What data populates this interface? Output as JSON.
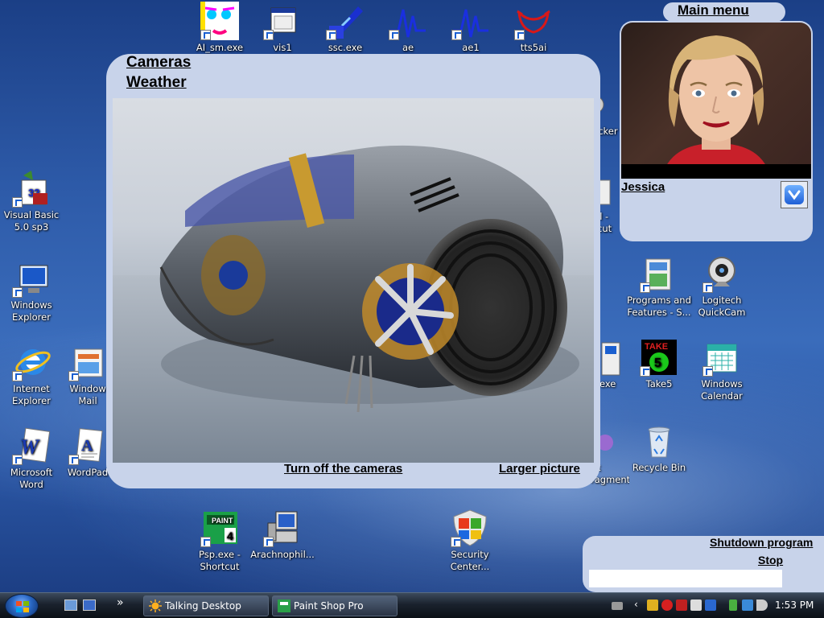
{
  "desktop_icons": [
    {
      "label": "AI_sm.exe",
      "icon": "ai-face-icon"
    },
    {
      "label": "vis1",
      "icon": "vis-app-icon"
    },
    {
      "label": "ssc.exe",
      "icon": "ssc-app-icon"
    },
    {
      "label": "ae",
      "icon": "waveform-icon"
    },
    {
      "label": "ae1",
      "icon": "waveform-icon"
    },
    {
      "label": "tts5ai",
      "icon": "tts-mouth-icon"
    },
    {
      "label": "Visual Basic\n5.0 sp3",
      "icon": "visual-basic-icon"
    },
    {
      "label": "Windows\nExplorer",
      "icon": "windows-explorer-icon"
    },
    {
      "label": "Internet\nExplorer",
      "icon": "internet-explorer-icon"
    },
    {
      "label": "Window\nMail",
      "icon": "windows-mail-icon"
    },
    {
      "label": "Microsoft\nWord",
      "icon": "word-icon"
    },
    {
      "label": "WordPad",
      "icon": "wordpad-icon"
    },
    {
      "label": "Psp.exe -\nShortcut",
      "icon": "paint-shop-pro-icon"
    },
    {
      "label": "Arachnophil...",
      "icon": "computer-icon"
    },
    {
      "label": "Security\nCenter...",
      "icon": "security-shield-icon"
    },
    {
      "label": "Programs and\nFeatures - S...",
      "icon": "programs-features-icon"
    },
    {
      "label": "Logitech\nQuickCam",
      "icon": "webcam-icon"
    },
    {
      "label": "Take5",
      "icon": "take5-icon"
    },
    {
      "label": "Windows\nCalendar",
      "icon": "calendar-icon"
    },
    {
      "label": "Recycle Bin",
      "icon": "recycle-bin-icon"
    },
    {
      "label": "icker",
      "icon": "partial-icon"
    },
    {
      "label": "il -\ncut",
      "icon": "partial-icon"
    },
    {
      "label": "p.exe",
      "icon": "partial-icon"
    },
    {
      "label": "sk\nragmenter",
      "icon": "partial-icon"
    }
  ],
  "camera_panel": {
    "cameras_link": "Cameras",
    "weather_link": "Weather",
    "turn_off_link": "Turn off the cameras",
    "larger_picture_link": "Larger picture"
  },
  "avatar_panel": {
    "main_menu_link": "Main menu",
    "character_name": "Jessica"
  },
  "shutdown_panel": {
    "shutdown_link": "Shutdown program",
    "stop_link": "Stop",
    "input_value": ""
  },
  "taskbar": {
    "buttons": [
      {
        "label": "Talking Desktop",
        "icon": "sun-icon"
      },
      {
        "label": "Paint Shop Pro",
        "icon": "paint-shop-pro-icon"
      }
    ],
    "clock": "1:53 PM",
    "overflow_glyph": "»"
  },
  "colors": {
    "panel": "#c8d3ea",
    "desktop": "#2d5aa8",
    "taskbar": "#1a222d"
  }
}
